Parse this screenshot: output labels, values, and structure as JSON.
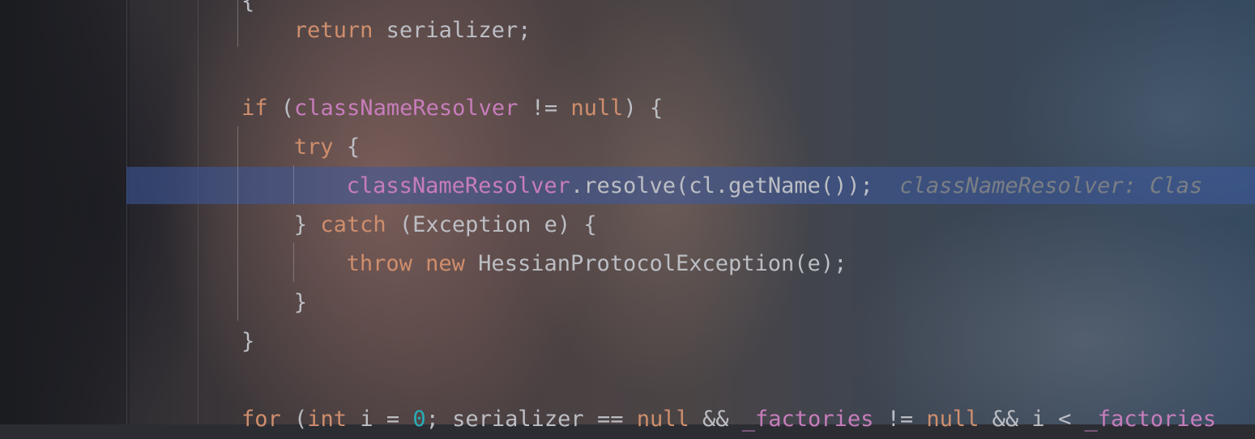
{
  "editor": {
    "lines": [
      {
        "indent": "    ",
        "parts": [
          {
            "cls": "kw",
            "text": "return"
          },
          {
            "cls": "",
            "text": " serializer;"
          }
        ]
      },
      {
        "indent": "",
        "parts": []
      },
      {
        "indent": "",
        "parts": [
          {
            "cls": "kw",
            "text": "if"
          },
          {
            "cls": "",
            "text": " ("
          },
          {
            "cls": "fld",
            "text": "classNameResolver"
          },
          {
            "cls": "",
            "text": " != "
          },
          {
            "cls": "kw",
            "text": "null"
          },
          {
            "cls": "",
            "text": ") {"
          }
        ]
      },
      {
        "indent": "    ",
        "parts": [
          {
            "cls": "kw",
            "text": "try"
          },
          {
            "cls": "",
            "text": " {"
          }
        ]
      },
      {
        "indent": "        ",
        "parts": [
          {
            "cls": "fld",
            "text": "classNameResolver"
          },
          {
            "cls": "",
            "text": ".resolve(cl.getName());"
          },
          {
            "cls": "hint",
            "text": "  classNameResolver: Clas"
          }
        ]
      },
      {
        "indent": "    ",
        "parts": [
          {
            "cls": "",
            "text": "} "
          },
          {
            "cls": "kw",
            "text": "catch"
          },
          {
            "cls": "",
            "text": " (Exception e) {"
          }
        ]
      },
      {
        "indent": "        ",
        "parts": [
          {
            "cls": "kw",
            "text": "throw"
          },
          {
            "cls": "",
            "text": " "
          },
          {
            "cls": "kw",
            "text": "new"
          },
          {
            "cls": "",
            "text": " HessianProtocolException(e);"
          }
        ]
      },
      {
        "indent": "    ",
        "parts": [
          {
            "cls": "",
            "text": "}"
          }
        ]
      },
      {
        "indent": "",
        "parts": [
          {
            "cls": "",
            "text": "}"
          }
        ]
      },
      {
        "indent": "",
        "parts": []
      },
      {
        "indent": "",
        "parts": [
          {
            "cls": "kw",
            "text": "for"
          },
          {
            "cls": "",
            "text": " ("
          },
          {
            "cls": "kw",
            "text": "int"
          },
          {
            "cls": "",
            "text": " i = "
          },
          {
            "cls": "num",
            "text": "0"
          },
          {
            "cls": "",
            "text": "; serializer == "
          },
          {
            "cls": "kw",
            "text": "null"
          },
          {
            "cls": "",
            "text": " && "
          },
          {
            "cls": "fld",
            "text": "_factories"
          },
          {
            "cls": "",
            "text": " != "
          },
          {
            "cls": "kw",
            "text": "null"
          },
          {
            "cls": "",
            "text": " && i < "
          },
          {
            "cls": "fld",
            "text": "_factories"
          }
        ]
      }
    ],
    "top_partial_line": "{",
    "colors": {
      "keyword": "#cf8e6d",
      "field": "#c77dbb",
      "number": "#2aacb8",
      "text": "#bcbec4",
      "hint": "#7a7e85",
      "current_line": "#3c5aa0"
    }
  }
}
